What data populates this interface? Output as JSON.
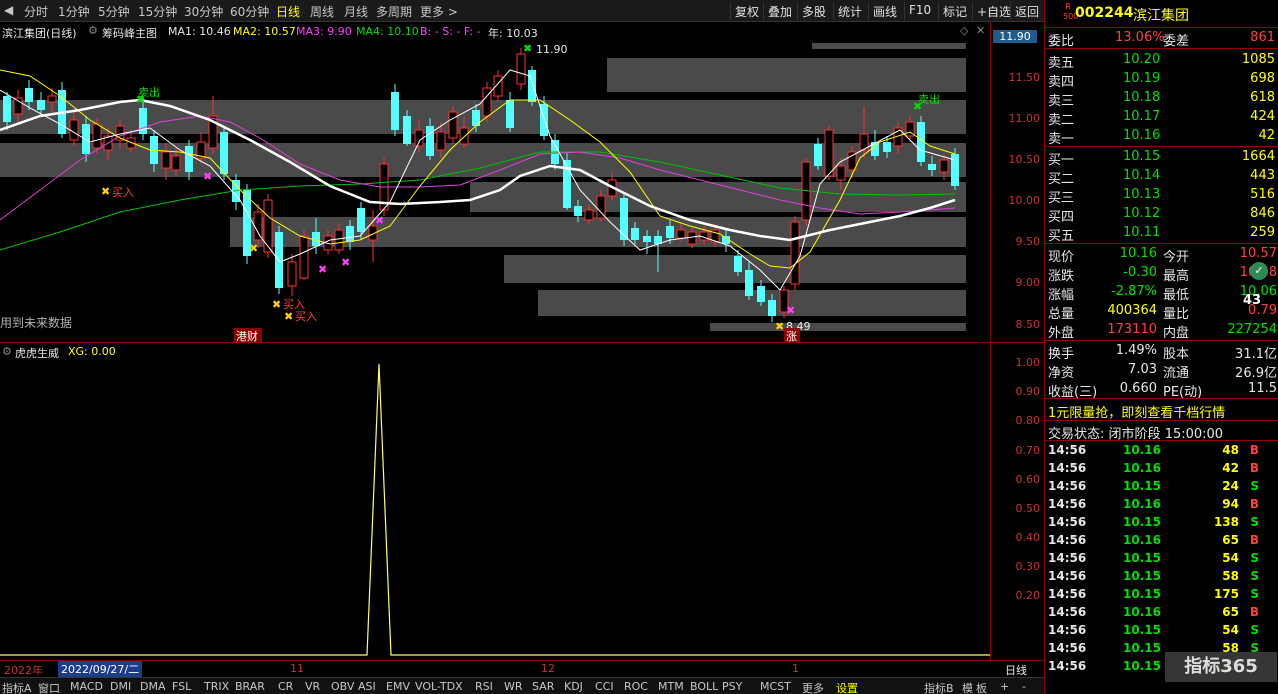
{
  "toolbar": {
    "periods": [
      "分时",
      "1分钟",
      "5分钟",
      "15分钟",
      "30分钟",
      "60分钟",
      "日线",
      "周线",
      "月线",
      "多周期",
      "更多 >"
    ],
    "active_period": "日线",
    "right_buttons": [
      "复权",
      "叠加",
      "多股",
      "统计",
      "画线",
      "F10",
      "标记",
      "+自选",
      "返回"
    ]
  },
  "infobar": {
    "stock": "滨江集团(日线)",
    "indicator": "筹码峰主图",
    "ma1": "MA1: 10.46",
    "ma2": "MA2: 10.57",
    "ma3": "MA3: 9.90",
    "ma4": "MA4: 10.10",
    "bsf": "B: -   S: -   F: -",
    "year": "年: 10.03"
  },
  "main_chart": {
    "labels": {
      "high_price": "11.90",
      "low_price": "8.49",
      "sell_top": "卖出",
      "sell_right": "卖出",
      "buy1": "买入",
      "buy2": "买入",
      "buy3": "买入",
      "future": "用到未来数据",
      "event1": "港财",
      "event2": "涨"
    }
  },
  "sub_chart": {
    "title": "虎虎生威",
    "xg": "XG: 0.00"
  },
  "price_axis": {
    "current_tag": "11.90",
    "ticks": [
      "11.50",
      "11.00",
      "10.50",
      "10.00",
      "9.50",
      "9.00",
      "8.50"
    ],
    "sub_ticks": [
      "1.00",
      "0.90",
      "0.80",
      "0.70",
      "0.60",
      "0.50",
      "0.40",
      "0.30",
      "0.20"
    ]
  },
  "datebar": {
    "year": "2022年",
    "date": "2022/09/27/二",
    "m11": "11",
    "m12": "12",
    "m1": "1",
    "period": "日线"
  },
  "indicators": [
    "指标A",
    "窗口",
    "MACD",
    "DMI",
    "DMA",
    "FSL",
    "TRIX",
    "BRAR",
    "CR",
    "VR",
    "OBV",
    "ASI",
    "EMV",
    "VOL-TDX",
    "RSI",
    "WR",
    "SAR",
    "KDJ",
    "CCI",
    "ROC",
    "MTM",
    "BOLL",
    "PSY",
    "MCST",
    "更多",
    "设置"
  ],
  "indicators_right": [
    "指标B",
    "模",
    "板",
    "+",
    "-"
  ],
  "right_panel": {
    "r_badge": "R",
    "market": "500",
    "code": "002244",
    "name": "滨江集团",
    "weibi_label": "委比",
    "weibi": "13.06%",
    "weicha_label": "委差",
    "weicha": "861",
    "asks": [
      {
        "label": "卖五",
        "price": "10.20",
        "vol": "1085"
      },
      {
        "label": "卖四",
        "price": "10.19",
        "vol": "698"
      },
      {
        "label": "卖三",
        "price": "10.18",
        "vol": "618"
      },
      {
        "label": "卖二",
        "price": "10.17",
        "vol": "424"
      },
      {
        "label": "卖一",
        "price": "10.16",
        "vol": "42"
      }
    ],
    "bids": [
      {
        "label": "买一",
        "price": "10.15",
        "vol": "1664"
      },
      {
        "label": "买二",
        "price": "10.14",
        "vol": "443"
      },
      {
        "label": "买三",
        "price": "10.13",
        "vol": "516"
      },
      {
        "label": "买四",
        "price": "10.12",
        "vol": "846"
      },
      {
        "label": "买五",
        "price": "10.11",
        "vol": "259"
      }
    ],
    "stats": [
      {
        "l1": "现价",
        "v1": "10.16",
        "c1": "grn",
        "l2": "今开",
        "v2": "10.57",
        "c2": "red"
      },
      {
        "l1": "涨跌",
        "v1": "-0.30",
        "c1": "grn",
        "l2": "最高",
        "v2": "10.68",
        "c2": "red"
      },
      {
        "l1": "涨幅",
        "v1": "-2.87%",
        "c1": "grn",
        "l2": "最低",
        "v2": "10.06",
        "c2": "grn"
      },
      {
        "l1": "总量",
        "v1": "400364",
        "c1": "yel",
        "l2": "量比",
        "v2": "0.79",
        "c2": "red"
      },
      {
        "l1": "外盘",
        "v1": "173110",
        "c1": "red",
        "l2": "内盘",
        "v2": "227254",
        "c2": "grn"
      }
    ],
    "stats2": [
      {
        "l1": "换手",
        "v1": "1.49%",
        "l2": "股本",
        "v2": "31.1亿"
      },
      {
        "l1": "净资",
        "v1": "7.03",
        "l2": "流通",
        "v2": "26.9亿"
      },
      {
        "l1": "收益(三)",
        "v1": "0.660",
        "l2": "PE(动)",
        "v2": "11.5"
      }
    ],
    "badge_pct": "43",
    "ad": "1元限量抢，即刻查看千档行情",
    "trade_status_label": "交易状态:",
    "trade_status": "闭市阶段",
    "trade_time": "15:00:00",
    "trades": [
      {
        "t": "14:56",
        "p": "10.16",
        "v": "48",
        "s": "B"
      },
      {
        "t": "14:56",
        "p": "10.16",
        "v": "42",
        "s": "B"
      },
      {
        "t": "14:56",
        "p": "10.15",
        "v": "24",
        "s": "S"
      },
      {
        "t": "14:56",
        "p": "10.16",
        "v": "94",
        "s": "B"
      },
      {
        "t": "14:56",
        "p": "10.15",
        "v": "138",
        "s": "S"
      },
      {
        "t": "14:56",
        "p": "10.16",
        "v": "65",
        "s": "B"
      },
      {
        "t": "14:56",
        "p": "10.15",
        "v": "54",
        "s": "S"
      },
      {
        "t": "14:56",
        "p": "10.15",
        "v": "58",
        "s": "S"
      },
      {
        "t": "14:56",
        "p": "10.15",
        "v": "175",
        "s": "S"
      },
      {
        "t": "14:56",
        "p": "10.16",
        "v": "65",
        "s": "B"
      },
      {
        "t": "14:56",
        "p": "10.15",
        "v": "54",
        "s": "S"
      },
      {
        "t": "14:56",
        "p": "10.15",
        "v": "58",
        "s": "S"
      },
      {
        "t": "14:56",
        "p": "10.15",
        "v": "175",
        "s": "S"
      }
    ],
    "watermark": "指标365"
  }
}
